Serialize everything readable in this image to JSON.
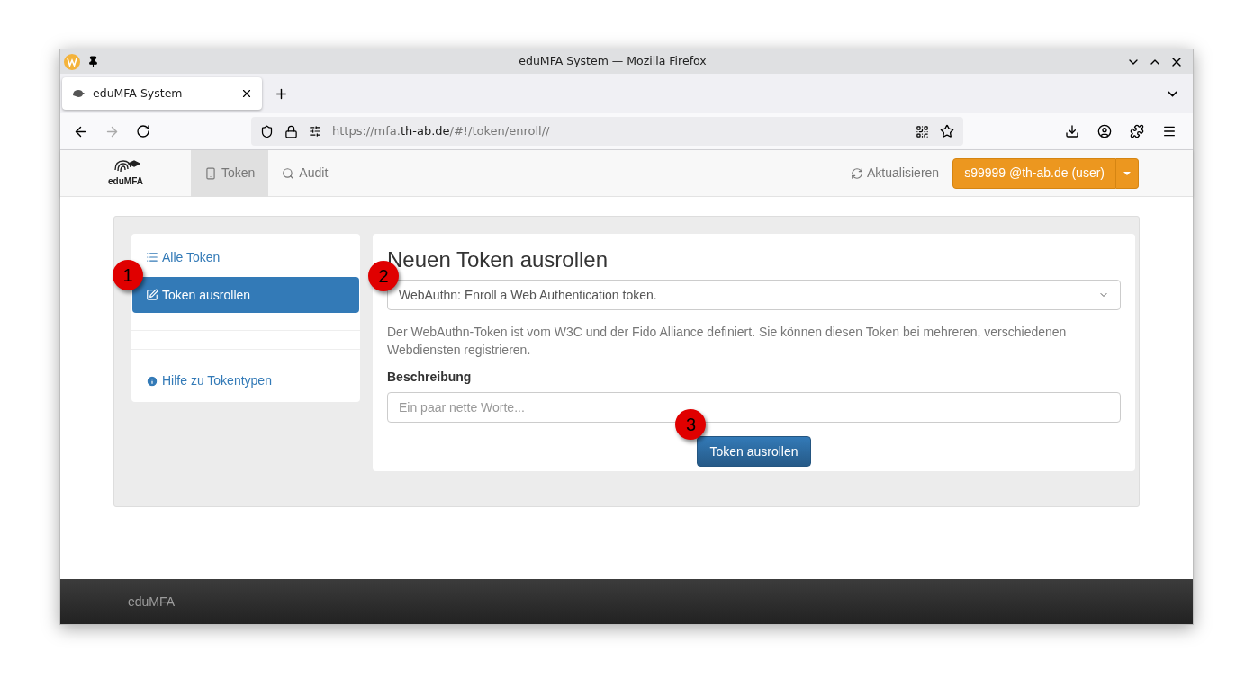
{
  "window": {
    "title": "eduMFA System — Mozilla Firefox"
  },
  "browser_tabs": [
    {
      "label": "eduMFA System",
      "selected": true
    }
  ],
  "url": {
    "prefix": "https://mfa.",
    "host": "th-ab.de",
    "path": "/#!/token/enroll//"
  },
  "app_nav": {
    "brand": "eduMFA",
    "items": [
      {
        "label": "Token",
        "selected": true
      },
      {
        "label": "Audit",
        "selected": false
      }
    ],
    "refresh": "Aktualisieren",
    "user_button": "s99999 @th-ab.de (user)"
  },
  "sidebar": {
    "items": [
      {
        "label": "Alle Token",
        "selected": false
      },
      {
        "label": "Token ausrollen",
        "selected": true,
        "callout": "1"
      }
    ],
    "help_link": "Hilfe zu Tokentypen"
  },
  "form": {
    "heading": "Neuen Token ausrollen",
    "token_type": "WebAuthn: Enroll a Web Authentication token.",
    "type_callout": "2",
    "description": "Der WebAuthn-Token ist vom W3C und der Fido Alliance definiert. Sie können diesen Token bei mehreren, verschiedenen Webdiensten registrieren.",
    "field_label": "Beschreibung",
    "placeholder": "Ein paar nette Worte...",
    "submit": "Token ausrollen",
    "submit_callout": "3"
  },
  "footer": {
    "brand": "eduMFA"
  }
}
